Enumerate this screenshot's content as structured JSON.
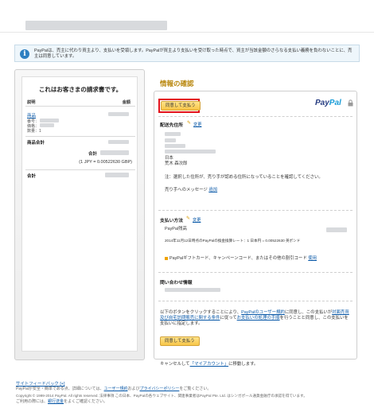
{
  "notice": {
    "text": "PayPalは、売主に代わり買主より、支払いを受領します。PayPalが買主より支払いを受け取った時点で、買主が当該金額のさらなる支払い義務を負わないことに、売主は同意しています。"
  },
  "summary": {
    "title": "これはお客さまの請求書です。",
    "col_description": "説明",
    "col_amount": "金額",
    "item_name": "商品",
    "item_number_label": "番号：",
    "item_price_label": "価格：",
    "item_quantity": "数量：1",
    "subtotal_label": "商品合計",
    "total_label": "合計",
    "exchange_rate": "(1 JPY = 0.00522630 GBP)",
    "grand_total_label": "合計"
  },
  "main": {
    "title": "情報の確認",
    "pay_button_top": "同意して支払う",
    "paypal_logo_a": "Pay",
    "paypal_logo_b": "Pal",
    "shipping": {
      "title": "配送先住所",
      "edit": "変更",
      "country": "日本",
      "name_line": "荒木 森次郎",
      "note": "注：選択した住所が、売り手が認める住所になっていることを確認してください。",
      "message_label": "売り手へのメッセージ",
      "message_link": "追加"
    },
    "payment": {
      "title": "支払い方法",
      "edit": "変更",
      "method": "PayPal残高",
      "conversion": "2014年11月12日時点のPayPalの換金換算レート：1 日本円 = 0.00522630 英ポンド",
      "gift_text": "PayPalギフトカード、キャンペーンコード、またはその他の割引コード",
      "gift_link": "使用"
    },
    "contact": {
      "title": "問い合わせ情報"
    },
    "agreement": {
      "prefix": "以下のボタンをクリックすることにより、",
      "link1": "PayPalのユーザー規約",
      "mid1": "に同意し、この支払いが",
      "link2": "対面売買及び自宅訪問販売に関する条件",
      "mid2": "に従って",
      "link3": "お支払いの処理の手順",
      "suffix": "を行うことと同意し、この支払いを支払いに指定します。"
    },
    "pay_button_bottom": "同意して支払う"
  },
  "cancel": {
    "prefix": "キャンセルして",
    "link": "「マイアカウント」",
    "suffix": "に移動します。"
  },
  "footer": {
    "feedback": "サイトフィードバック",
    "feedback_mark": "[+]",
    "privacy_prefix": "PayPalが安全・簡単である点、詳細については、",
    "privacy_link1": "ユーザー規約",
    "privacy_mid": "および",
    "privacy_link2": "プライバシーポリシー",
    "privacy_suffix": "をご覧ください。",
    "copyright": "Copyright © 1999-2014 PayPal. All rights reserved. 法律事項 この日本、PayPalの各ウェブサイト、関連事業者はPayPal Pte. Ltd. はシンガポール通貨金融庁の承認を得ています。",
    "consumer_prefix": "ご利用の際には、",
    "consumer_link": "銀行送金",
    "consumer_suffix": "をよくご確認ください。"
  }
}
